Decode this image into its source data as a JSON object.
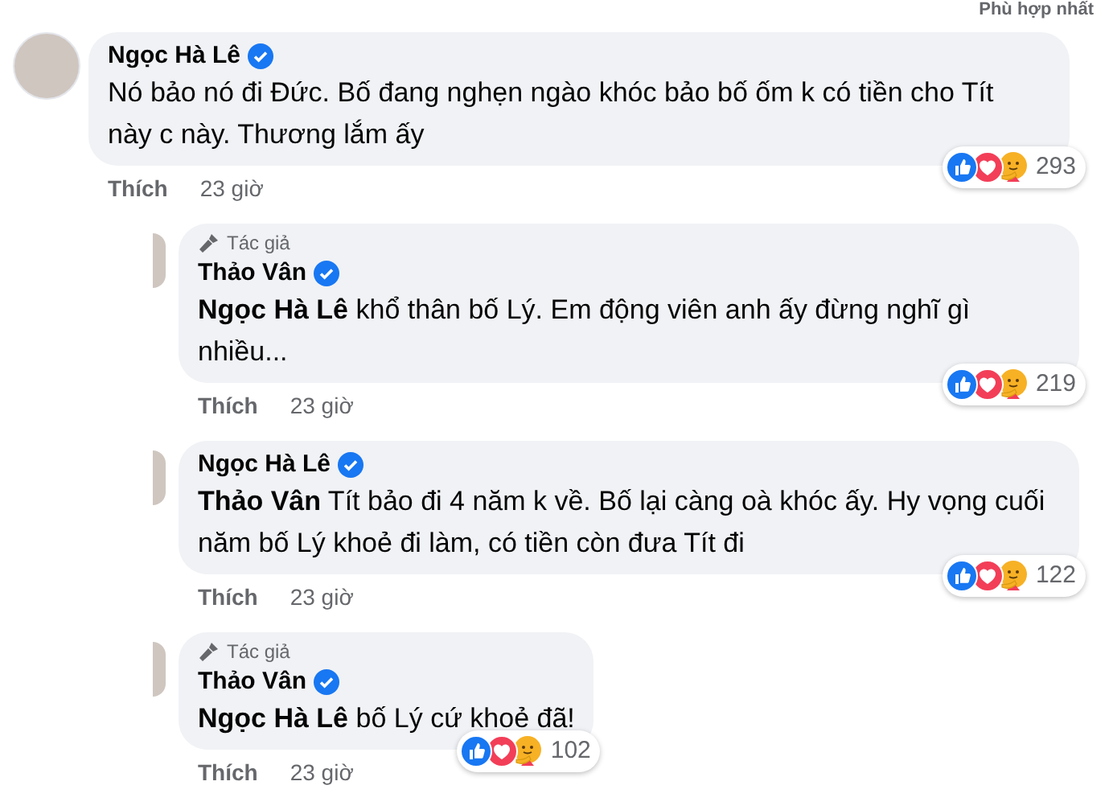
{
  "sort_label": "Phù hợp nhất",
  "comments": [
    {
      "author": "Ngọc Hà Lê",
      "verified": true,
      "text": "Nó bảo nó đi Đức. Bố đang nghẹn ngào khóc bảo bố ốm k có tiền cho Tít này c này. Thương lắm ấy",
      "reaction_count": "293",
      "like_label": "Thích",
      "time": "23 giờ",
      "children": [
        {
          "author_badge": "Tác giả",
          "author": "Thảo Vân",
          "verified": true,
          "text": "**Ngọc Hà Lê** khổ thân bố Lý. Em động viên anh ấy đừng nghĩ gì nhiều...",
          "reaction_count": "219",
          "like_label": "Thích",
          "time": "23 giờ"
        },
        {
          "author": "Ngọc Hà Lê",
          "verified": true,
          "text": "**Thảo Vân** Tít bảo đi 4 năm k về. Bố lại càng oà khóc ấy. Hy vọng cuối năm bố Lý khoẻ đi làm, có tiền còn đưa Tít đi",
          "reaction_count": "122",
          "like_label": "Thích",
          "time": "23 giờ"
        },
        {
          "author_badge": "Tác giả",
          "author": "Thảo Vân",
          "verified": true,
          "text": "**Ngọc Hà Lê** bố Lý cứ khoẻ đã!",
          "reaction_count": "102",
          "like_label": "Thích",
          "time": "23 giờ"
        }
      ]
    }
  ]
}
